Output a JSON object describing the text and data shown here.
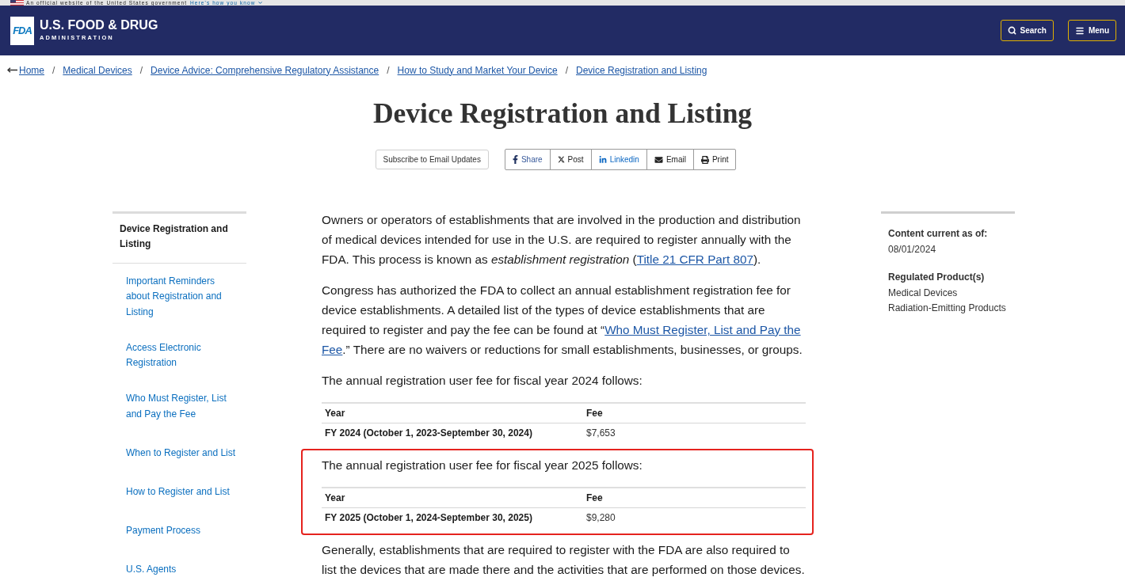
{
  "gov_banner": {
    "text": "An official website of the United States government",
    "link": "Here's how you know"
  },
  "header": {
    "logo_text": "FDA",
    "agency": "U.S. FOOD & DRUG",
    "subtitle": "ADMINISTRATION",
    "buttons": [
      {
        "label": "Search",
        "kind": "search"
      },
      {
        "label": "Menu",
        "kind": "menu"
      }
    ]
  },
  "breadcrumbs": {
    "separator": "/",
    "items": [
      "Home",
      "Medical Devices",
      "Device Advice: Comprehensive Regulatory Assistance",
      "How to Study and Market Your Device",
      "Device Registration and Listing"
    ]
  },
  "title": "Device Registration and Listing",
  "subscribe_button": "Subscribe to Email Updates",
  "share_buttons": [
    {
      "label": "Share",
      "kind": "facebook"
    },
    {
      "label": "Post",
      "kind": "x"
    },
    {
      "label": "Linkedin",
      "kind": "linkedin"
    },
    {
      "label": "Email",
      "kind": "email"
    },
    {
      "label": "Print",
      "kind": "print"
    }
  ],
  "sidebar": {
    "heading": "Device Registration and Listing",
    "items": [
      "Important Reminders about Registration and Listing",
      "Access Electronic Registration",
      "Who Must Register, List and Pay the Fee",
      "When to Register and List",
      "How to Register and List",
      "Payment Process",
      "U.S. Agents"
    ]
  },
  "content": [
    {
      "kind": "paragraph",
      "segments": [
        {
          "kind": "text",
          "text": "Owners or operators of establishments that are involved in the production and distribution of medical devices intended for use in the U.S. are required to register annually with the FDA. This process is known as *establishment registration* ("
        },
        {
          "kind": "link",
          "text": "Title 21 CFR Part 807"
        },
        {
          "kind": "text",
          "text": ")."
        }
      ]
    },
    {
      "kind": "paragraph",
      "segments": [
        {
          "kind": "text",
          "text": "Congress has authorized the FDA to collect an annual establishment registration fee for device establishments. A detailed list of the types of device establishments that are required to register and pay the fee can be found at “"
        },
        {
          "kind": "link",
          "text": "Who Must Register, List and Pay the"
        },
        {
          "kind": "link",
          "text": "Fee"
        },
        {
          "kind": "text",
          "text": ".” There are no waivers or reductions for small establishments, businesses, or groups."
        }
      ]
    },
    {
      "kind": "fee_section",
      "highlighted": false,
      "intro": "The annual registration user fee for fiscal year 2024 follows:",
      "columns": [
        "Year",
        "Fee"
      ],
      "rows": [
        [
          "FY 2024 (October 1, 2023-September 30, 2024)",
          "$7,653"
        ]
      ]
    },
    {
      "kind": "fee_section",
      "highlighted": true,
      "intro": "The annual registration user fee for fiscal year 2025 follows:",
      "columns": [
        "Year",
        "Fee"
      ],
      "rows": [
        [
          "FY 2025 (October 1, 2024-September 30, 2025)",
          "$9,280"
        ]
      ]
    },
    {
      "kind": "paragraph",
      "segments": [
        {
          "kind": "text",
          "text": "Generally, establishments that are required to register with the FDA are also required to list the devices that are made there and the activities that are performed on those devices."
        }
      ]
    }
  ],
  "aside": [
    {
      "heading": "Content current as of:",
      "values": [
        "08/01/2024"
      ]
    },
    {
      "heading": "Regulated Product(s)",
      "values": [
        "Medical Devices",
        "Radiation-Emitting Products"
      ]
    }
  ]
}
